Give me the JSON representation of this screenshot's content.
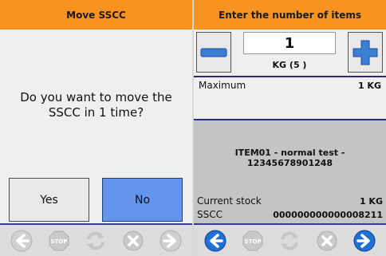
{
  "move_screen": {
    "title": "Move SSCC",
    "question_line1": "Do you want to move the",
    "question_line2": "SSCC in 1 time?",
    "yes_label": "Yes",
    "no_label": "No"
  },
  "quantity_screen": {
    "title": "Enter the number of items",
    "quantity": "1",
    "unit": "KG (5 )",
    "maximum_label": "Maximum",
    "maximum_value": "1 KG",
    "item_description": "ITEM01 - normal test - 12345678901248",
    "current_stock_label": "Current stock",
    "current_stock_value": "1 KG",
    "sscc_label": "SSCC",
    "sscc_value": "000000000000008211"
  },
  "toolbar_icons": [
    "back-arrow-icon",
    "stop-icon",
    "refresh-icon",
    "cancel-icon",
    "forward-arrow-icon"
  ],
  "toolbar_states": {
    "move_screen": {
      "back": "disabled",
      "stop": "disabled",
      "refresh": "disabled",
      "cancel": "disabled",
      "forward": "disabled"
    },
    "quantity_screen": {
      "back": "enabled",
      "stop": "disabled",
      "refresh": "disabled",
      "cancel": "disabled",
      "forward": "enabled"
    }
  },
  "colors": {
    "title_bar": "#f7931e",
    "no_button": "#6495ed",
    "blue_accent": "#1e6fd6",
    "separator": "#2a2a7a",
    "disabled_icon": "#b5b5b5"
  }
}
